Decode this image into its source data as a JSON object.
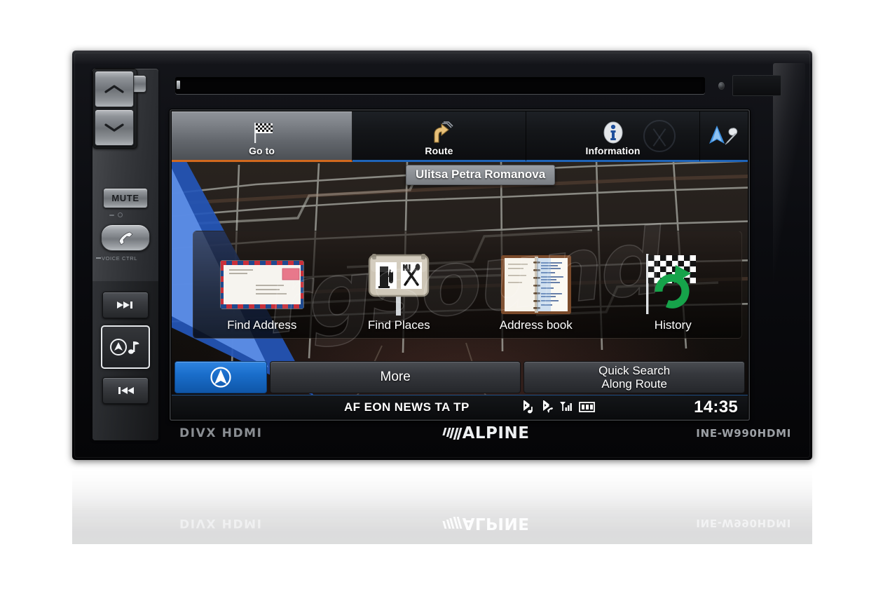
{
  "device": {
    "model": "INE-W990HDMI",
    "brand": "ALPINE",
    "codecs": "DIVX HDMI"
  },
  "physical_buttons": [
    {
      "name": "eject",
      "glyph": "▲",
      "label": ""
    },
    {
      "name": "volume-up",
      "glyph": "⌃",
      "label": ""
    },
    {
      "name": "volume-down",
      "glyph": "⌄",
      "label": ""
    },
    {
      "name": "mute",
      "glyph": "MUTE",
      "label": "MUTE"
    },
    {
      "name": "phone",
      "glyph": "✆",
      "label": "VOICE CTRL"
    },
    {
      "name": "next-track",
      "glyph": "▶▶▌",
      "label": ""
    },
    {
      "name": "nav-audio",
      "glyph": "",
      "label": ""
    },
    {
      "name": "prev-track",
      "glyph": "▌◀◀",
      "label": ""
    }
  ],
  "tabs": [
    {
      "label": "Go to",
      "icon": "checkered-flag-icon",
      "active": true,
      "underline": "#d2691e"
    },
    {
      "label": "Route",
      "icon": "route-arrow-icon",
      "active": false,
      "underline": "#1f64b8"
    },
    {
      "label": "Information",
      "icon": "info-icon",
      "active": false,
      "underline": "#1f64b8"
    },
    {
      "label": "",
      "icon": "nav-settings-icon",
      "active": false,
      "underline": "#1f64b8"
    }
  ],
  "map": {
    "street_label": "Ulitsa Petra Romanova",
    "road_color": "#c6c9c1",
    "ground_color": "#2a241f"
  },
  "menu": {
    "items": [
      {
        "label": "Find Address",
        "icon": "envelope-icon"
      },
      {
        "label": "Find Places",
        "icon": "poi-sign-icon"
      },
      {
        "label": "Address book",
        "icon": "notebook-icon"
      },
      {
        "label": "History",
        "icon": "flag-refresh-icon"
      }
    ]
  },
  "actions": {
    "nav_button_icon": "compass-arrow-icon",
    "more_label": "More",
    "quick_search_line1": "Quick Search",
    "quick_search_line2": "Along Route"
  },
  "status": {
    "rds": "AF EON NEWS TA TP",
    "icons": [
      "bluetooth-audio-icon",
      "bluetooth-phone-icon",
      "signal-bars-icon",
      "battery-icon"
    ],
    "clock": "14:35"
  },
  "watermark": {
    "text": "rgsound"
  },
  "colors": {
    "accent_blue": "#1f64b8",
    "active_orange": "#d2691e",
    "nav_button_blue": "#1a6ecb",
    "history_green": "#16a34a"
  }
}
